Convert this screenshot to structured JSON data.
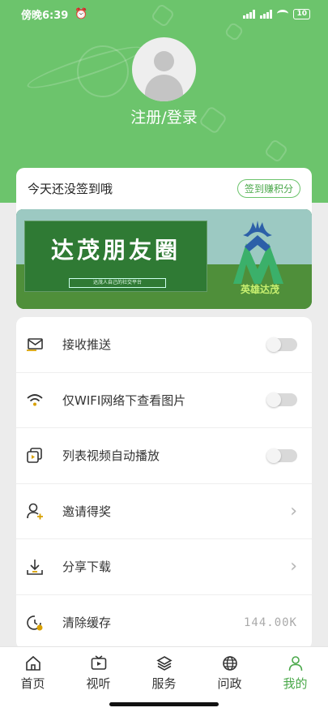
{
  "status_bar": {
    "time": "傍晚6:39",
    "battery": "10"
  },
  "profile": {
    "login_text": "注册/登录"
  },
  "signin": {
    "title": "今天还没签到哦",
    "button": "签到赚积分"
  },
  "banner": {
    "title": "达茂朋友圈",
    "subtitle": "达茂人自己的社交平台",
    "logo_text": "英雄达茂"
  },
  "settings": [
    {
      "name": "push",
      "icon": "envelope-icon",
      "label": "接收推送",
      "control": "toggle",
      "on": false
    },
    {
      "name": "wifi-images",
      "icon": "wifi-icon",
      "label": "仅WIFI网络下查看图片",
      "control": "toggle",
      "on": false
    },
    {
      "name": "autoplay",
      "icon": "video-stack-icon",
      "label": "列表视频自动播放",
      "control": "toggle",
      "on": false
    },
    {
      "name": "invite",
      "icon": "user-add-icon",
      "label": "邀请得奖",
      "control": "chevron"
    },
    {
      "name": "share-download",
      "icon": "download-icon",
      "label": "分享下载",
      "control": "chevron"
    },
    {
      "name": "clear-cache",
      "icon": "clock-clean-icon",
      "label": "清除缓存",
      "control": "value",
      "value": "144.00K"
    }
  ],
  "tabs": [
    {
      "label": "首页",
      "icon": "home-icon"
    },
    {
      "label": "视听",
      "icon": "tv-icon"
    },
    {
      "label": "服务",
      "icon": "layers-icon"
    },
    {
      "label": "问政",
      "icon": "globe-icon"
    },
    {
      "label": "我的",
      "icon": "person-icon",
      "active": true
    }
  ],
  "colors": {
    "brand_green": "#6cc46c",
    "active_tab": "#4aa84a",
    "background": "#ececec"
  }
}
